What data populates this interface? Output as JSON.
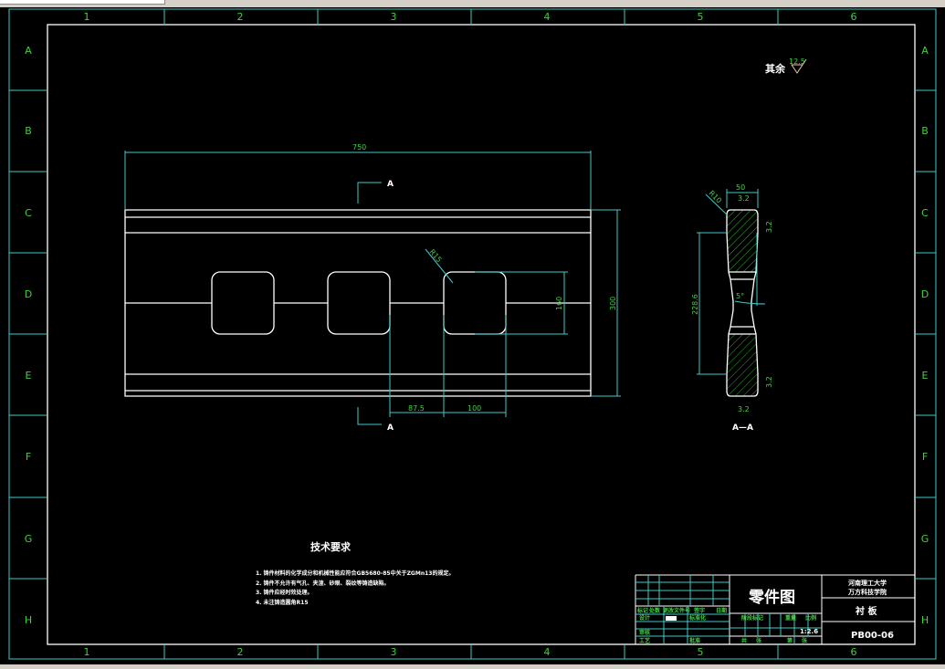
{
  "window": {
    "command_input": ""
  },
  "frame": {
    "columns": [
      "1",
      "2",
      "3",
      "4",
      "5",
      "6"
    ],
    "rows": [
      "A",
      "B",
      "C",
      "D",
      "E",
      "F",
      "G",
      "H"
    ]
  },
  "roughness": {
    "label": "其余",
    "value": "12.5"
  },
  "main_view": {
    "dim_length": "750",
    "dim_height": "300",
    "dim_hole": "160",
    "dim_offset": "87.5",
    "dim_hole_width": "100",
    "dim_radius": "R15",
    "section_mark": "A"
  },
  "section_view": {
    "dim_width": "50",
    "dim_radius": "R10",
    "dim_height": "228.6",
    "angle": "5°",
    "roughness": [
      "3.2",
      "3.2",
      "3.2",
      "3.2"
    ],
    "label": "A—A"
  },
  "tech_requirements": {
    "title": "技术要求",
    "items": [
      "1. 铸件材料的化学成分和机械性能应符合GB5680-85中关于ZGMn13的规定。",
      "2. 铸件不允许有气孔、夹渣、砂眼、裂纹等铸造缺陷。",
      "3. 铸件应经时效处理。",
      "4. 未注铸造圆角R15"
    ]
  },
  "title_block": {
    "drawing_type": "零件图",
    "school_line1": "河南理工大学",
    "school_line2": "万方科技学院",
    "part_name": "衬  板",
    "drawing_no": "PB00-06",
    "scale": "1:2.6",
    "labels": {
      "mark": "标记",
      "count": "处数",
      "change_doc": "更改文件号",
      "sign": "签字",
      "date": "日期",
      "design": "设计",
      "standard": "标准化",
      "review": "审核",
      "process": "工艺",
      "approve": "批准",
      "stage": "阶段标记",
      "weight": "重量",
      "ratio": "比例",
      "total": "共",
      "sheets1": "张",
      "page": "第",
      "sheets2": "张"
    }
  }
}
